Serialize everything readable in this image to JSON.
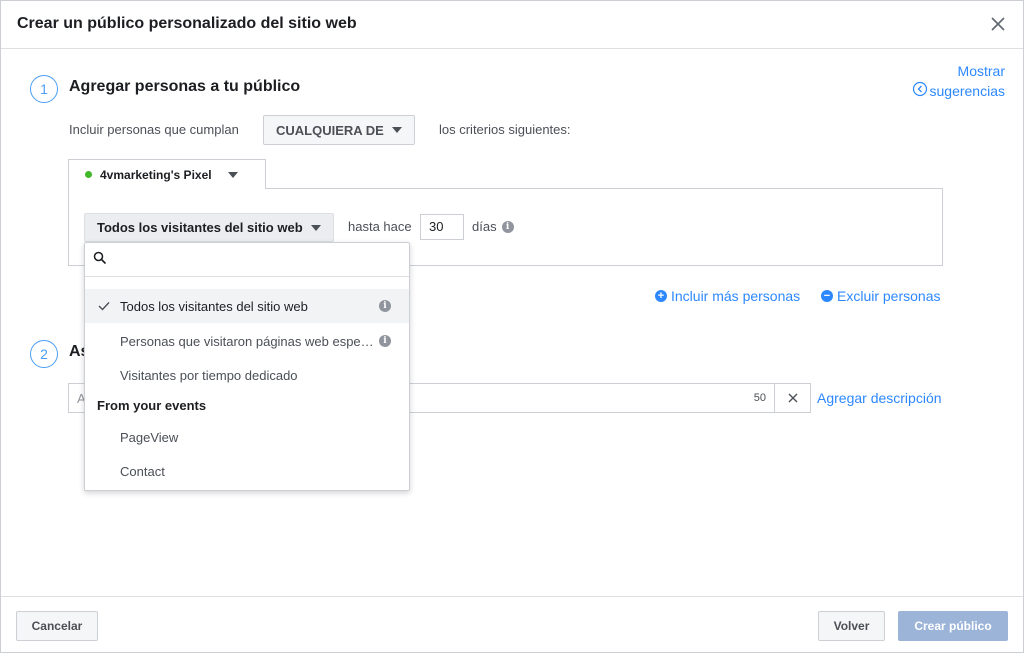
{
  "header": {
    "title": "Crear un público personalizado del sitio web"
  },
  "suggestions": {
    "line1": "Mostrar",
    "line2": "sugerencias"
  },
  "step1": {
    "number": "1",
    "title": "Agregar personas a tu público",
    "include_label": "Incluir personas que cumplan",
    "match_value": "CUALQUIERA DE",
    "criteria_label": "los criterios siguientes:",
    "pixel_name": "4vmarketing's Pixel",
    "rule_value": "Todos los visitantes del sitio web",
    "since_label": "hasta hace",
    "days_value": "30",
    "days_label": "días",
    "include_more": "Incluir más personas",
    "exclude": "Excluir personas"
  },
  "step2": {
    "number": "2",
    "title_visible": "As",
    "name_placeholder": "A",
    "char_count": "50",
    "add_description": "Agregar descripción"
  },
  "dropdown": {
    "search_placeholder": "",
    "items": [
      {
        "label": "Todos los visitantes del sitio web",
        "selected": true,
        "info": true
      },
      {
        "label": "Personas que visitaron páginas web específicas",
        "selected": false,
        "info": true
      },
      {
        "label": "Visitantes por tiempo dedicado",
        "selected": false,
        "info": false
      }
    ],
    "group_label": "From your events",
    "event_items": [
      "PageView",
      "Contact"
    ]
  },
  "footer": {
    "cancel": "Cancelar",
    "back": "Volver",
    "create": "Crear público"
  },
  "colors": {
    "accent": "#2d88ff",
    "step": "#4b9ff5",
    "pixel_active": "#42b72a",
    "primary_disabled": "#9cb4d8"
  }
}
